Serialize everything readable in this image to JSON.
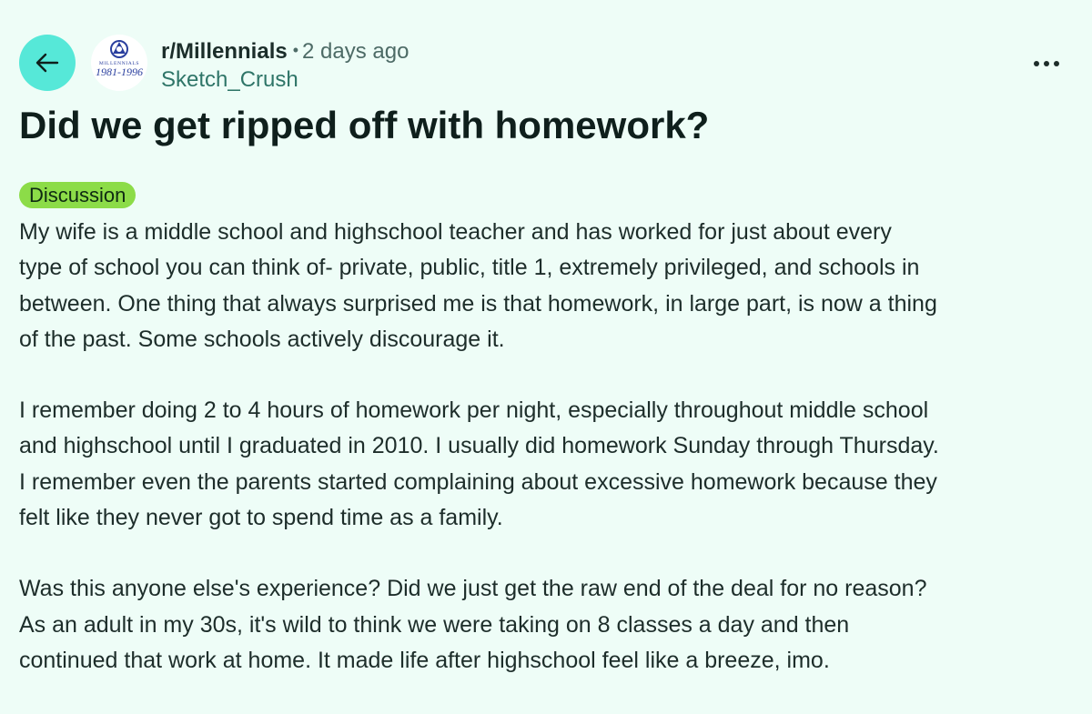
{
  "header": {
    "subreddit": "r/Millennials",
    "separator": "•",
    "time": "2 days ago",
    "author": "Sketch_Crush",
    "avatar": {
      "top_text": "MILLENNIALS",
      "years_text": "1981-1996",
      "logo_color": "#2a3f9e"
    },
    "back_icon": "arrow-left-icon",
    "more_icon": "ellipsis-icon"
  },
  "post": {
    "title": "Did we get ripped off with homework?",
    "flair": "Discussion",
    "paragraphs": [
      [
        "My wife is a middle school and highschool teacher and has worked for just about every",
        "type of school you can think of- private, public, title 1, extremely privileged, and schools in",
        "between. One thing that always surprised me is that homework, in large part, is now a thing",
        "of the past. Some schools actively discourage it."
      ],
      [
        "I remember doing 2 to 4 hours of homework per night, especially throughout middle school",
        "and highschool until I graduated in 2010. I usually did homework Sunday through Thursday.",
        "I remember even the parents started complaining about excessive homework because they",
        "felt like they never got to spend time as a family."
      ],
      [
        "Was this anyone else's experience? Did we just get the raw end of the deal for no reason?",
        "As an adult in my 30s, it's wild to think we were taking on 8 classes a day and then",
        "continued that work at home. It made life after highschool feel like a breeze, imo."
      ]
    ]
  },
  "colors": {
    "background": "#eefdf7",
    "back_button": "#56e8d8",
    "flair": "#8cdc48",
    "author": "#2f7568"
  }
}
